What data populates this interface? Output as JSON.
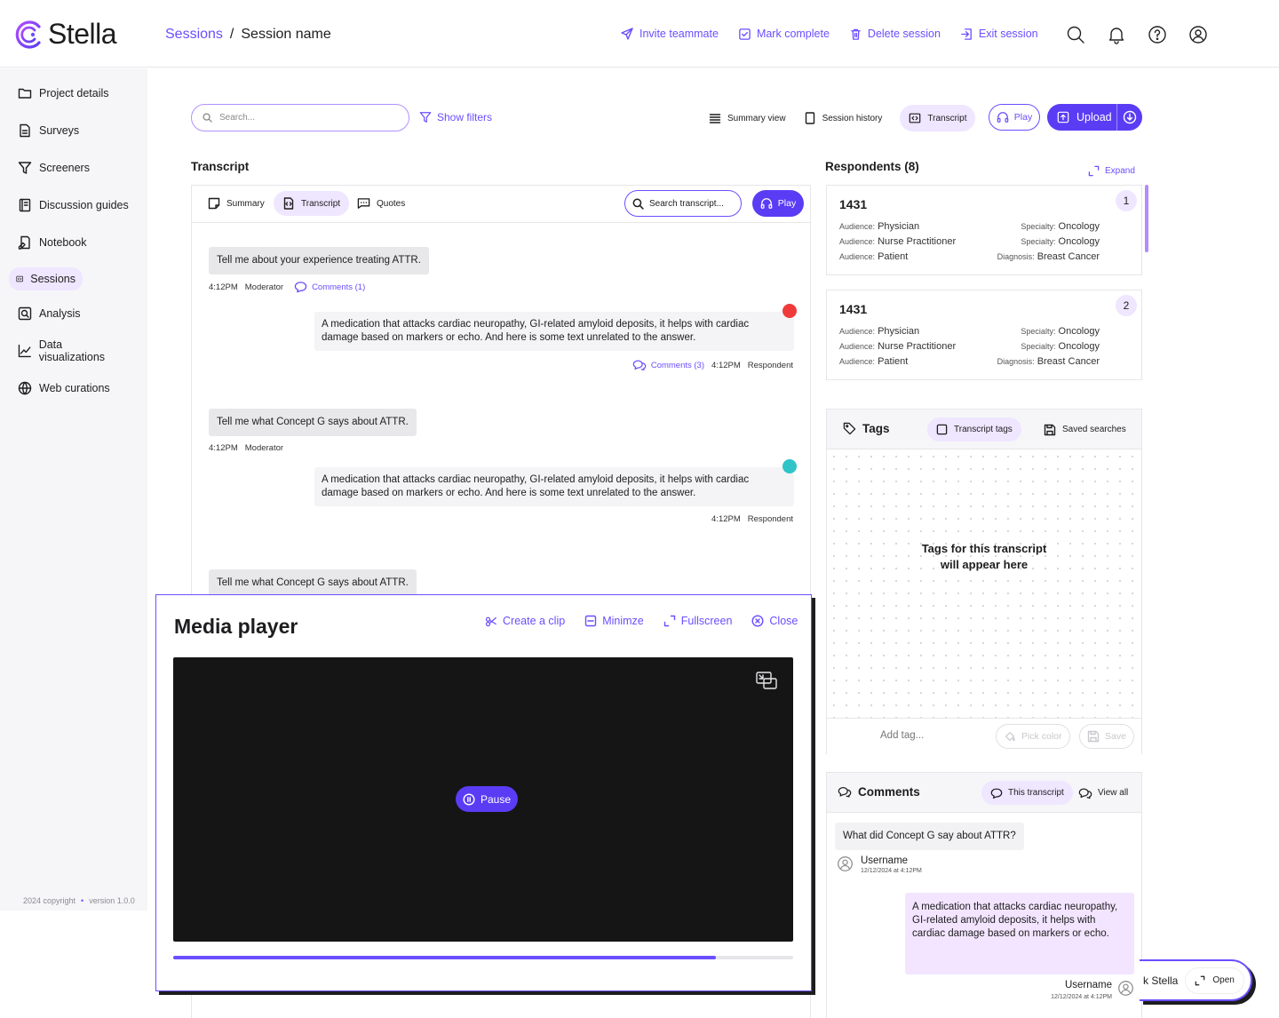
{
  "brand": {
    "name": "Stella",
    "accent": "#6b4eff"
  },
  "breadcrumb": {
    "parent": "Sessions",
    "separator": "/",
    "current": "Session name"
  },
  "header_actions": [
    "Invite teammate",
    "Mark complete",
    "Delete session",
    "Exit session"
  ],
  "header_icons": [
    "search-icon",
    "bell-icon",
    "help-icon",
    "user-icon"
  ],
  "sidebar": {
    "items": [
      {
        "label": "Project details",
        "icon": "folder-icon"
      },
      {
        "label": "Surveys",
        "icon": "document-icon"
      },
      {
        "label": "Screeners",
        "icon": "filter-icon"
      },
      {
        "label": "Discussion guides",
        "icon": "book-icon"
      },
      {
        "label": "Notebook",
        "icon": "notebook-icon"
      },
      {
        "label": "Sessions",
        "icon": "sessions-icon",
        "active": true
      },
      {
        "label": "Analysis",
        "icon": "analysis-icon"
      },
      {
        "label": "Data visualizations",
        "icon": "chart-icon"
      },
      {
        "label": "Web curations",
        "icon": "globe-icon"
      }
    ],
    "copyright": "2024 copyright",
    "bullet": "•",
    "version": "version 1.0.0"
  },
  "toolbar": {
    "search_placeholder": "Search...",
    "show_filters": "Show filters",
    "views": [
      "Summary view",
      "Session history",
      "Transcript"
    ],
    "active_view": "Transcript",
    "play": "Play",
    "upload": "Upload"
  },
  "transcript": {
    "title": "Transcript",
    "tabs": [
      "Summary",
      "Transcript",
      "Quotes"
    ],
    "active_tab": "Transcript",
    "search_placeholder": "Search transcript...",
    "play": "Play",
    "entries": [
      {
        "question": "Tell me about your experience treating ATTR.",
        "time": "4:12PM",
        "role": "Moderator",
        "comments": "Comments (1)",
        "answer": "A medication that attacks cardiac neuropathy, GI-related amyloid deposits, it helps with cardiac damage based on markers or echo. And here is some text unrelated to the answer.",
        "answer_comments": "Comments (3)",
        "answer_time": "4:12PM",
        "answer_role": "Respondent",
        "dot_color": "#f03a3a"
      },
      {
        "question": "Tell me what Concept G says about ATTR.",
        "time": "4:12PM",
        "role": "Moderator",
        "answer": "A medication that attacks cardiac neuropathy, GI-related amyloid deposits, it helps with cardiac damage based on markers or echo. And here is some text unrelated to the answer.",
        "answer_time": "4:12PM",
        "answer_role": "Respondent",
        "dot_color": "#2ec4c8"
      },
      {
        "question": "Tell me what Concept G says about ATTR."
      }
    ]
  },
  "respondents": {
    "title": "Respondents (8)",
    "expand": "Expand",
    "cards": [
      {
        "id": "1431",
        "badge": "1",
        "left": [
          {
            "k": "Audience:",
            "v": "Physician"
          },
          {
            "k": "Audience:",
            "v": "Nurse Practitioner"
          },
          {
            "k": "Audience:",
            "v": "Patient"
          }
        ],
        "right": [
          {
            "k": "Specialty:",
            "v": "Oncology"
          },
          {
            "k": "Specialty:",
            "v": "Oncology"
          },
          {
            "k": "Diagnosis:",
            "v": "Breast Cancer"
          }
        ]
      },
      {
        "id": "1431",
        "badge": "2",
        "left": [
          {
            "k": "Audience:",
            "v": "Physician"
          },
          {
            "k": "Audience:",
            "v": "Nurse Practitioner"
          },
          {
            "k": "Audience:",
            "v": "Patient"
          }
        ],
        "right": [
          {
            "k": "Specialty:",
            "v": "Oncology"
          },
          {
            "k": "Specialty:",
            "v": "Oncology"
          },
          {
            "k": "Diagnosis:",
            "v": "Breast Cancer"
          }
        ]
      }
    ]
  },
  "tags": {
    "title": "Tags",
    "tab_transcript": "Transcript tags",
    "tab_saved": "Saved searches",
    "empty_line1": "Tags for this transcript",
    "empty_line2": "will appear here",
    "add_placeholder": "Add tag...",
    "pick_color": "Pick color",
    "save": "Save"
  },
  "comments": {
    "title": "Comments",
    "tab_this": "This transcript",
    "tab_all": "View all",
    "question": "What did Concept G say about ATTR?",
    "user1": "Username",
    "date1": "12/12/2024 at 4:12PM",
    "answer": "A medication that attacks cardiac neuropathy, GI-related amyloid deposits, it helps with cardiac damage based on markers or echo.",
    "user2": "Username",
    "date2": "12/12/2024 at 4:12PM"
  },
  "ask_stella": {
    "label": "k Stella",
    "open": "Open"
  },
  "media_player": {
    "title": "Media player",
    "actions": [
      "Create a clip",
      "Minimze",
      "Fullscreen",
      "Close"
    ],
    "pause": "Pause",
    "progress": 0.875
  }
}
